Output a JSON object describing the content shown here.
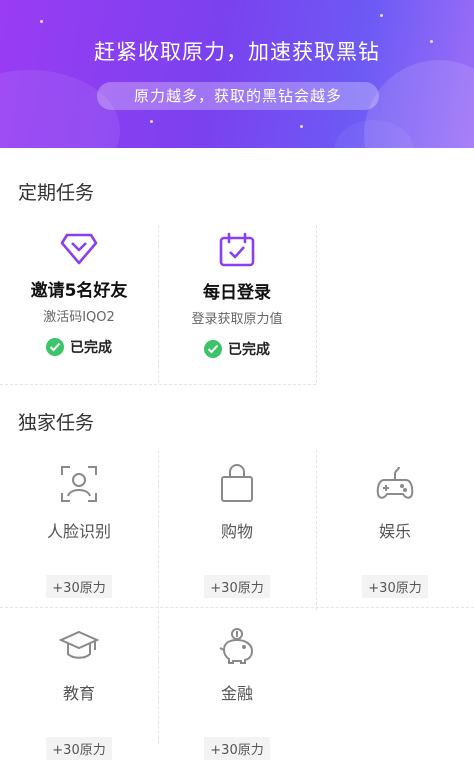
{
  "banner": {
    "title": "赶紧收取原力，加速获取黑钻",
    "subtitle": "原力越多，获取的黑钻会越多"
  },
  "regular_section": {
    "title": "定期任务",
    "tasks": [
      {
        "icon": "diamond-icon",
        "name": "邀请5名好友",
        "desc": "激活码IQO2",
        "status": "已完成"
      },
      {
        "icon": "calendar-check-icon",
        "name": "每日登录",
        "desc": "登录获取原力值",
        "status": "已完成"
      }
    ]
  },
  "exclusive_section": {
    "title": "独家任务",
    "tasks": [
      {
        "icon": "face-recognition-icon",
        "name": "人脸识别",
        "points": "+30原力"
      },
      {
        "icon": "shopping-bag-icon",
        "name": "购物",
        "points": "+30原力"
      },
      {
        "icon": "gamepad-icon",
        "name": "娱乐",
        "points": "+30原力"
      },
      {
        "icon": "graduation-cap-icon",
        "name": "教育",
        "points": "+30原力"
      },
      {
        "icon": "piggy-bank-icon",
        "name": "金融",
        "points": "+30原力"
      }
    ]
  },
  "colors": {
    "accent": "#8a3ff2",
    "success": "#3cc46b"
  }
}
